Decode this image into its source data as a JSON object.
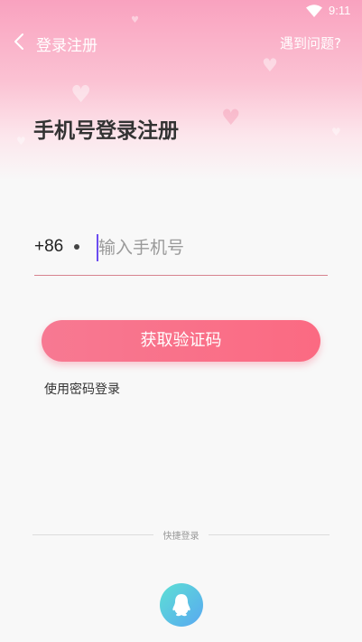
{
  "status_bar": {
    "time": "9:11",
    "icons": [
      "wifi-icon"
    ]
  },
  "nav": {
    "back_icon": "chevron-left-icon",
    "title": "登录注册",
    "help_link": "遇到问题?"
  },
  "page": {
    "title": "手机号登录注册"
  },
  "phone_form": {
    "country_code": "+86",
    "phone_placeholder": "输入手机号",
    "phone_value": ""
  },
  "actions": {
    "get_code_label": "获取验证码",
    "password_login_label": "使用密码登录"
  },
  "quick_login": {
    "label": "快捷登录",
    "providers": [
      {
        "name": "qq",
        "icon": "qq-penguin-icon"
      }
    ]
  },
  "colors": {
    "accent": "#f97088",
    "header_gradient_top": "#f9a2bf",
    "input_underline": "#d7838f",
    "cursor": "#6b4cf0",
    "quick_login_gradient": [
      "#5de0d4",
      "#59a8f1"
    ]
  }
}
